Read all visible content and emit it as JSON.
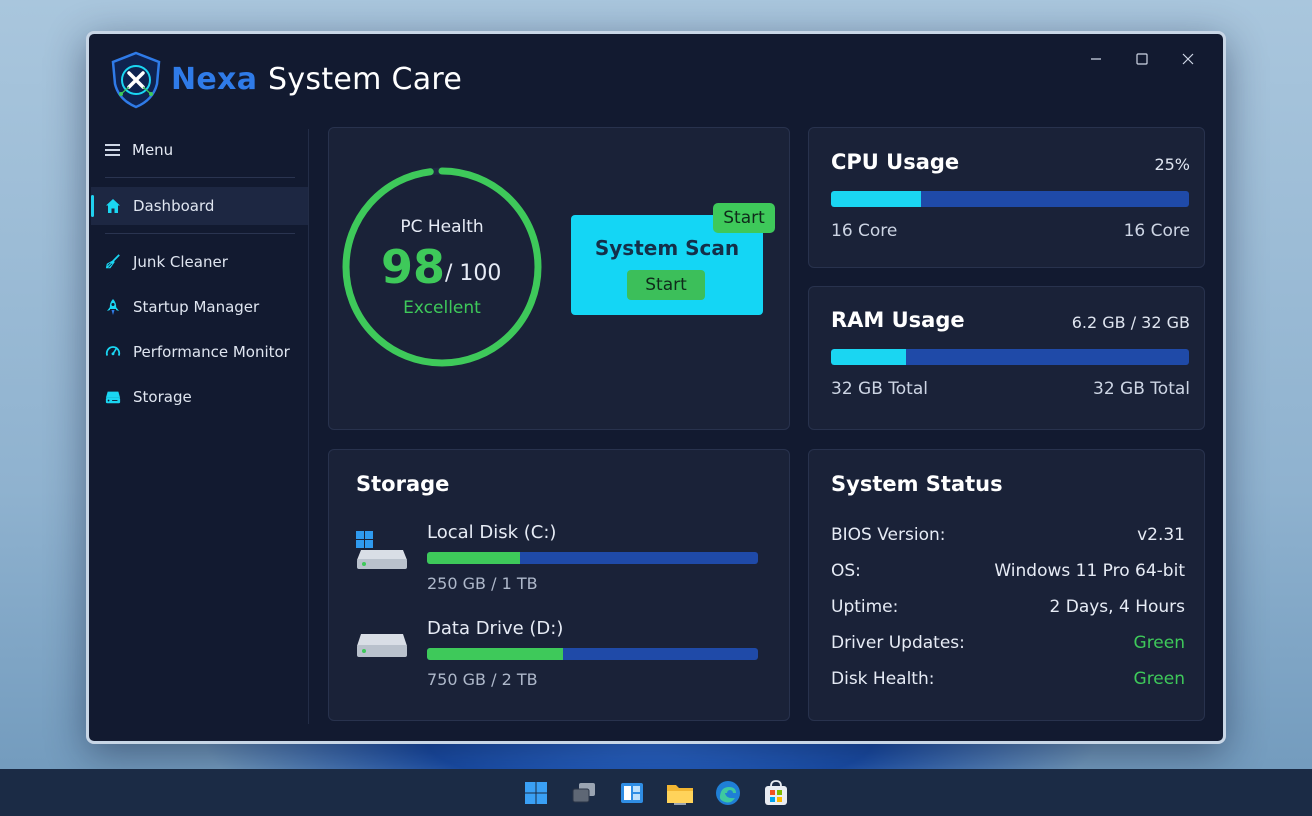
{
  "app": {
    "brand": "Nexa",
    "title_rest": "System Care"
  },
  "window_controls": {
    "minimize_icon": "minimize-icon",
    "maximize_icon": "maximize-icon",
    "close_icon": "close-icon"
  },
  "sidebar": {
    "menu_label": "Menu",
    "items": [
      {
        "label": "Dashboard",
        "icon": "home-icon",
        "active": true
      },
      {
        "label": "Junk Cleaner",
        "icon": "broom-icon",
        "active": false
      },
      {
        "label": "Startup Manager",
        "icon": "rocket-icon",
        "active": false
      },
      {
        "label": "Performance Monitor",
        "icon": "gauge-icon",
        "active": false
      },
      {
        "label": "Storage",
        "icon": "drive-icon",
        "active": false
      }
    ]
  },
  "health": {
    "label": "PC Health",
    "score": "98",
    "max": "/ 100",
    "status": "Excellent",
    "ring_fraction": 0.98
  },
  "scan": {
    "title": "System Scan",
    "start_label": "Start",
    "badge_label": "Start"
  },
  "cpu": {
    "title": "CPU Usage",
    "value": "25%",
    "fraction": 0.25,
    "left_label": "16 Core",
    "right_label": "16 Core"
  },
  "ram": {
    "title": "RAM Usage",
    "value": "6.2 GB / 32 GB",
    "fraction": 0.21,
    "left_label": "32 GB Total",
    "right_label": "32 GB Total"
  },
  "storage": {
    "title": "Storage",
    "disks": [
      {
        "name": "Local Disk (C:)",
        "size": "250 GB / 1 TB",
        "fraction": 0.28
      },
      {
        "name": "Data Drive (D:)",
        "size": "750 GB / 2 TB",
        "fraction": 0.41
      }
    ]
  },
  "system_status": {
    "title": "System Status",
    "rows": [
      {
        "label": "BIOS Version:",
        "value": "v2.31"
      },
      {
        "label": "OS:",
        "value": "Windows 11 Pro 64-bit"
      },
      {
        "label": "Uptime:",
        "value": "2 Days, 4 Hours"
      },
      {
        "label": "Driver Updates:",
        "value": "Green"
      },
      {
        "label": "Disk Health:",
        "value": "Green"
      }
    ]
  },
  "colors": {
    "accent": "#1ad6f2",
    "good": "#3ec95a",
    "brand": "#2f7be8"
  },
  "taskbar": {
    "icons": [
      "windows-start-icon",
      "task-view-icon",
      "widgets-icon",
      "file-explorer-icon",
      "edge-browser-icon",
      "store-icon"
    ]
  }
}
